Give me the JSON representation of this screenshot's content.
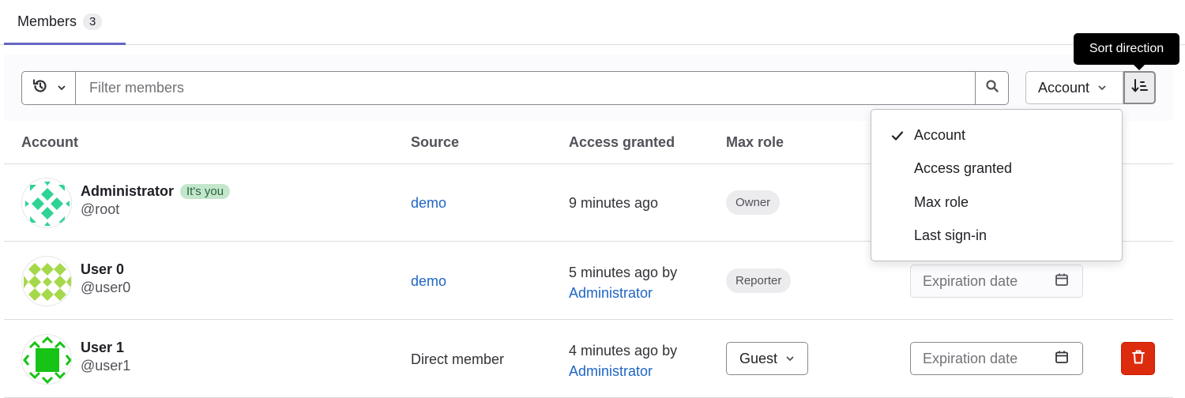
{
  "tabs": [
    {
      "label": "Members",
      "count": "3",
      "active": true
    }
  ],
  "filter": {
    "history_icon": "history-icon",
    "placeholder": "Filter members",
    "value": "",
    "search_icon": "search-icon"
  },
  "sort": {
    "selected": "Account",
    "direction_icon": "sort-lowest-icon",
    "tooltip": "Sort direction",
    "options": [
      {
        "label": "Account",
        "checked": true
      },
      {
        "label": "Access granted",
        "checked": false
      },
      {
        "label": "Max role",
        "checked": false
      },
      {
        "label": "Last sign-in",
        "checked": false
      }
    ]
  },
  "table": {
    "columns": [
      "Account",
      "Source",
      "Access granted",
      "Max role"
    ],
    "rows": [
      {
        "name": "Administrator",
        "badge": "It's you",
        "handle": "@root",
        "avatar_color": "#2fd394",
        "source": "demo",
        "source_is_link": true,
        "access_granted": "9 minutes ago",
        "granted_by": "",
        "role": "Owner",
        "role_editable": false,
        "expiration_placeholder": "",
        "expiration_editable": false,
        "show_expiration": false,
        "removable": false
      },
      {
        "name": "User 0",
        "badge": "",
        "handle": "@user0",
        "avatar_color": "#a6d84b",
        "source": "demo",
        "source_is_link": true,
        "access_granted": "5 minutes ago by",
        "granted_by": "Administrator",
        "role": "Reporter",
        "role_editable": false,
        "expiration_placeholder": "Expiration date",
        "expiration_editable": false,
        "show_expiration": true,
        "removable": false
      },
      {
        "name": "User 1",
        "badge": "",
        "handle": "@user1",
        "avatar_color": "#17c416",
        "source": "Direct member",
        "source_is_link": false,
        "access_granted": "4 minutes ago by",
        "granted_by": "Administrator",
        "role": "Guest",
        "role_editable": true,
        "expiration_placeholder": "Expiration date",
        "expiration_editable": true,
        "show_expiration": true,
        "removable": true
      }
    ]
  },
  "colors": {
    "tab_underline": "#6666c4",
    "link": "#1f65c5",
    "danger": "#dd2b0e",
    "you_badge_bg": "#c3e6cd",
    "you_badge_text": "#24663b"
  }
}
